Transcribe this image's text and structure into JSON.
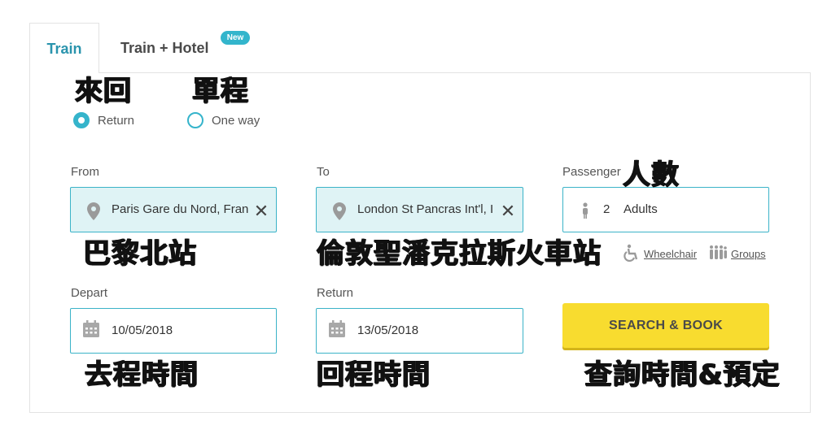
{
  "tabs": [
    {
      "label": "Train"
    },
    {
      "label": "Train + Hotel",
      "badge": "New"
    }
  ],
  "trip_type": {
    "options": [
      {
        "label": "Return",
        "selected": true
      },
      {
        "label": "One way",
        "selected": false
      }
    ]
  },
  "from": {
    "label": "From",
    "value": "Paris Gare du Nord, Fran",
    "icon": "location-pin-icon"
  },
  "to": {
    "label": "To",
    "value": "London St Pancras Int'l, I",
    "icon": "location-pin-icon"
  },
  "passengers": {
    "label": "Passenger",
    "count": "2",
    "type": "Adults",
    "icon": "person-icon"
  },
  "depart": {
    "label": "Depart",
    "value": "10/05/2018",
    "icon": "calendar-icon"
  },
  "return_date": {
    "label": "Return",
    "value": "13/05/2018",
    "icon": "calendar-icon"
  },
  "links": {
    "wheelchair": "Wheelchair",
    "groups": "Groups"
  },
  "search_button": "SEARCH & BOOK",
  "annotations": {
    "return": "來回",
    "one_way": "單程",
    "people": "人數",
    "paris": "巴黎北站",
    "london": "倫敦聖潘克拉斯火車站",
    "depart_time": "去程時間",
    "return_time": "回程時間",
    "search_book": "查詢時間&預定"
  },
  "colors": {
    "accent": "#35b4cb",
    "tab_active": "#2a94ad",
    "field_fill": "#dff3f5",
    "button": "#f8dc2f"
  }
}
